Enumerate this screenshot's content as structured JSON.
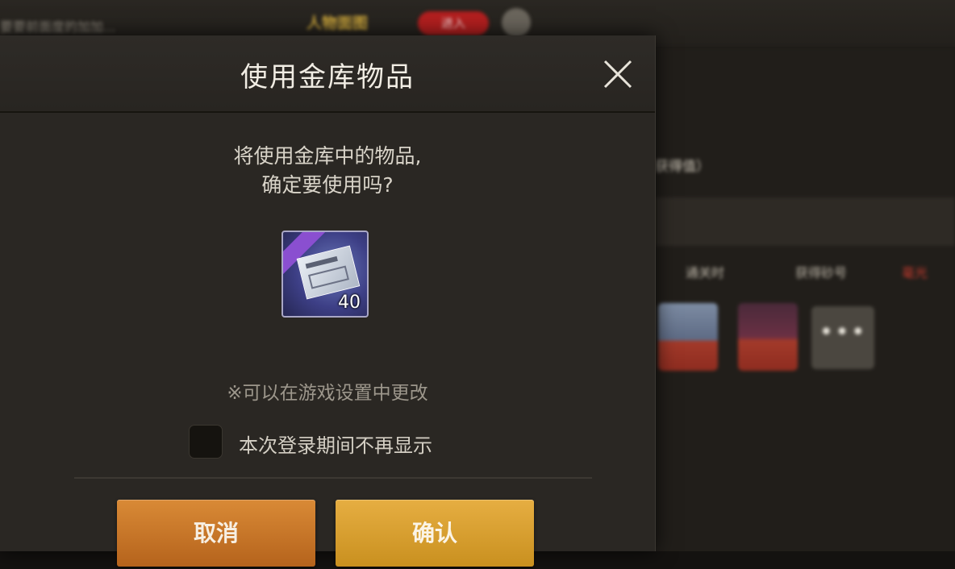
{
  "background": {
    "top_left_text": "要要前面度的加加...",
    "tab_label": "人物面图",
    "red_pill": "进入",
    "right_text": "获得值）",
    "filters": [
      "通关时",
      "获得砂号",
      "毫光"
    ],
    "more_label": "•••"
  },
  "dialog": {
    "title": "使用金库物品",
    "message_line1": "将使用金库中的物品,",
    "message_line2": "确定要使用吗?",
    "item": {
      "count": "40",
      "icon": "purple-ticket-icon"
    },
    "hint": "※可以在游戏设置中更改",
    "checkbox": {
      "label": "本次登录期间不再显示",
      "checked": false
    },
    "cancel_label": "取消",
    "confirm_label": "确认"
  },
  "colors": {
    "cancel_button": "#c9762a",
    "confirm_button": "#d9a034",
    "dialog_bg": "#2a2723"
  }
}
